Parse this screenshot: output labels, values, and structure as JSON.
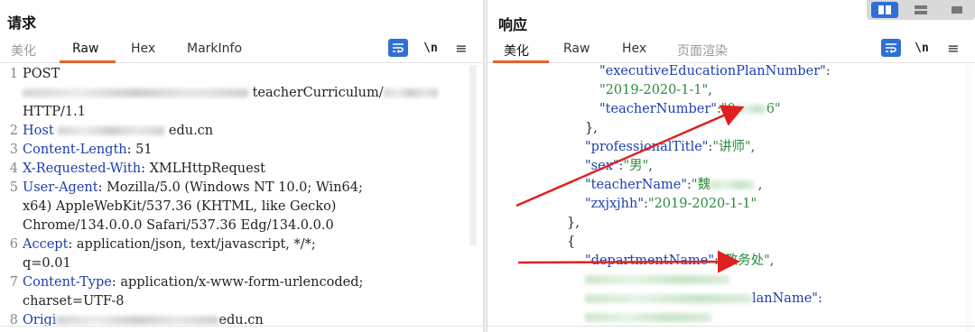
{
  "left": {
    "title": "请求",
    "tabs": [
      {
        "label": "美化"
      },
      {
        "label": "Raw"
      },
      {
        "label": "Hex"
      },
      {
        "label": "MarkInfo"
      }
    ],
    "tools": {
      "ln": "\\n",
      "menu": "≡"
    },
    "lines": [
      {
        "num": "1",
        "text": "POST"
      },
      {
        "num": "",
        "text": "teacherCurriculum/"
      },
      {
        "num": "",
        "text": "HTTP/1.1"
      },
      {
        "num": "2",
        "key": "Host",
        "text": " edu.cn"
      },
      {
        "num": "3",
        "key": "Content-Length",
        "text": ": 51"
      },
      {
        "num": "4",
        "key": "X-Requested-With",
        "text": ": XMLHttpRequest"
      },
      {
        "num": "5",
        "key": "User-Agent",
        "text": ": Mozilla/5.0 (Windows NT 10.0; Win64;"
      },
      {
        "num": "",
        "text": "x64) AppleWebKit/537.36 (KHTML, like Gecko)"
      },
      {
        "num": "",
        "text": "Chrome/134.0.0.0 Safari/537.36 Edg/134.0.0.0"
      },
      {
        "num": "6",
        "key": "Accept",
        "text": ": application/json, text/javascript, */*;"
      },
      {
        "num": "",
        "text": "q=0.01"
      },
      {
        "num": "7",
        "key": "Content-Type",
        "text": ": application/x-www-form-urlencoded;"
      },
      {
        "num": "",
        "text": "charset=UTF-8"
      },
      {
        "num": "8",
        "key": "Origi",
        "text": "edu.cn"
      }
    ]
  },
  "right": {
    "title": "响应",
    "tabs": [
      {
        "label": "美化"
      },
      {
        "label": "Raw"
      },
      {
        "label": "Hex"
      },
      {
        "label": "页面渲染"
      }
    ],
    "tools": {
      "ln": "\\n",
      "menu": "≡"
    },
    "json": {
      "l1_key": "\"executiveEducationPlanNumber\"",
      "l1_colon": ":",
      "l2_val": "\"2019-2020-1-1\"",
      "l2_comma": ",",
      "l3_key": "\"teacherNumber\"",
      "l3_colon": ":",
      "l3_val_start": "\"0",
      "l3_val_end": "6\"",
      "l4": "},",
      "l5_key": "\"professionalTitle\"",
      "l5_val": "\"讲师\"",
      "l6_key": "\"sex\"",
      "l6_val": "\"男\"",
      "l7_key": "\"teacherName\"",
      "l7_val_start": "\"魏",
      "l7_tail": ",",
      "l8_key": "\"zxjxjhh\"",
      "l8_val": "\"2019-2020-1-1\"",
      "l9": "},",
      "l10": "{",
      "l11_key": "\"departmentName\"",
      "l11_val": "\"教务处\"",
      "l13_tail": "lanName\":",
      "colon": ":",
      "comma": ","
    }
  },
  "colors": {
    "accent": "#e8622d",
    "key": "#1c3fae",
    "string": "#2b8a3e",
    "arrow": "#e02020",
    "toggle": "#2f6fd6"
  }
}
